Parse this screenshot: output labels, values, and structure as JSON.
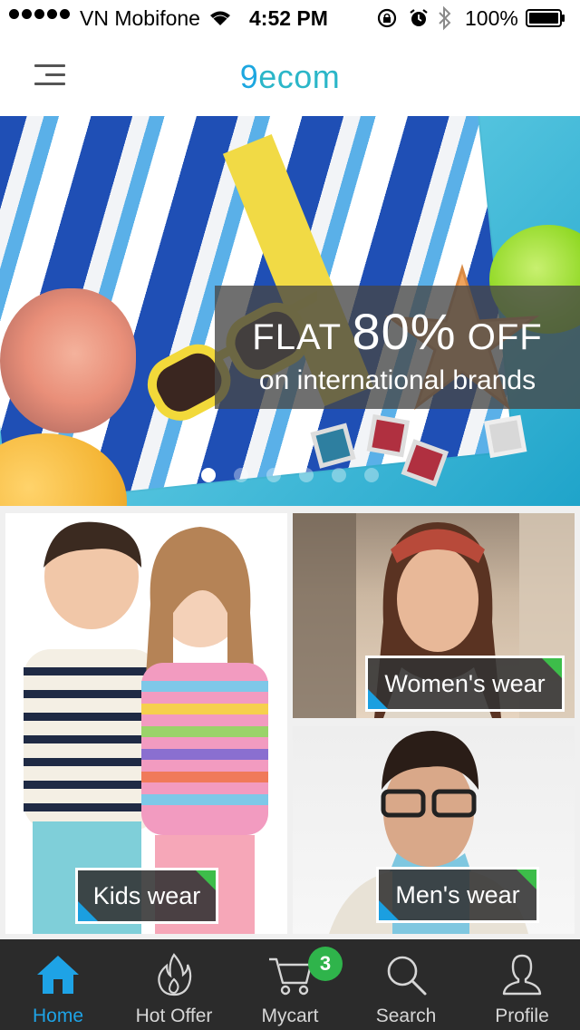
{
  "status_bar": {
    "carrier": "VN Mobifone",
    "time": "4:52 PM",
    "battery": "100%",
    "signal_dots": 5
  },
  "header": {
    "title_prefix": "9",
    "title_rest": "ecom"
  },
  "banner": {
    "promo_word1": "FLAT",
    "promo_percent": "80%",
    "promo_word2": "OFF",
    "promo_line2": "on international brands",
    "slide_count": 6,
    "active_slide": 1
  },
  "categories": {
    "kids": "Kids wear",
    "women": "Women's wear",
    "men": "Men's wear"
  },
  "tabs": [
    {
      "label": "Home",
      "icon": "home-icon",
      "active": true
    },
    {
      "label": "Hot Offer",
      "icon": "flame-icon",
      "active": false
    },
    {
      "label": "Mycart",
      "icon": "cart-icon",
      "active": false,
      "badge": "3"
    },
    {
      "label": "Search",
      "icon": "search-icon",
      "active": false
    },
    {
      "label": "Profile",
      "icon": "profile-icon",
      "active": false
    }
  ],
  "colors": {
    "accent_blue": "#1ea3e6",
    "brand_teal": "#2bb6c8",
    "badge_green": "#2fb44b",
    "tabbar_bg": "#2b2b2b"
  }
}
